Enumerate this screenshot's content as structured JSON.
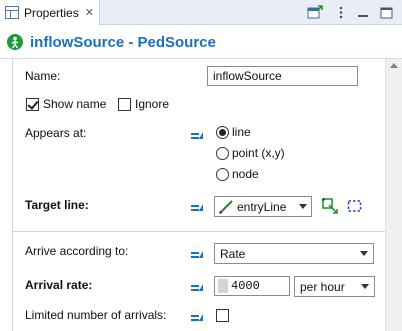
{
  "tab": {
    "label": "Properties",
    "close": "✕"
  },
  "title": "inflowSource - PedSource",
  "fields": {
    "name_label": "Name:",
    "name_value": "inflowSource",
    "show_name_label": "Show name",
    "show_name_checked": true,
    "ignore_label": "Ignore",
    "ignore_checked": false,
    "appears_at_label": "Appears at:",
    "appears_options": [
      "line",
      "point (x,y)",
      "node"
    ],
    "appears_selected": "line",
    "target_line_label": "Target line:",
    "target_line_value": "entryLine",
    "arrive_label": "Arrive according to:",
    "arrive_value": "Rate",
    "arrival_rate_label": "Arrival rate:",
    "arrival_rate_value": "4000",
    "arrival_rate_unit": "per hour",
    "limited_label": "Limited number of arrivals:",
    "limited_checked": false
  },
  "colors": {
    "accent": "#1b6fc1",
    "title_icon": "#1f9a3b"
  }
}
